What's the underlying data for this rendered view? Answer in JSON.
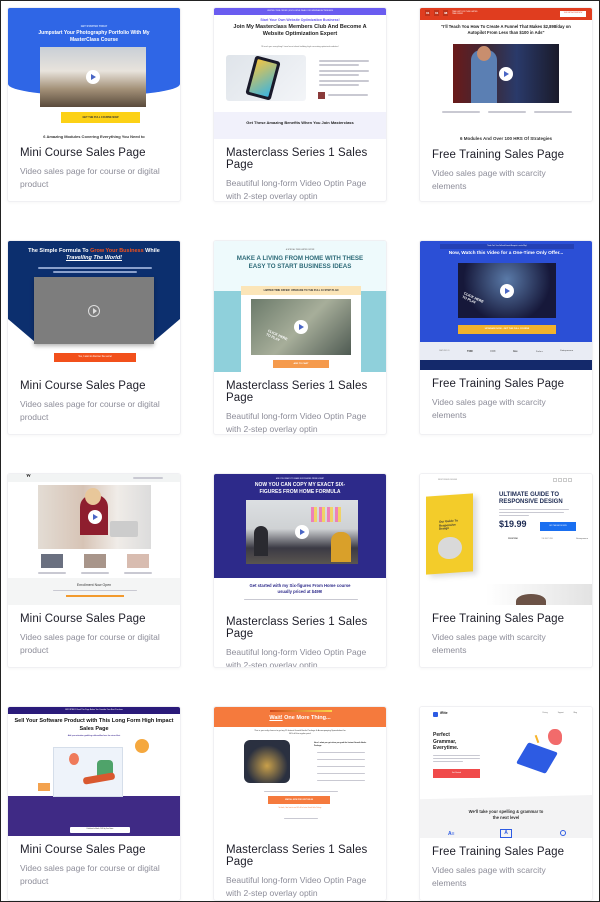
{
  "templates": [
    {
      "title": "Mini Course Sales Page",
      "description": "Video sales page for course or digital product",
      "preview": {
        "eyebrow": "GET STARTED TODAY",
        "headline": "Jumpstart Your Photography Portfolio With My MasterClass Course",
        "cta": "GET THE FULL COURSE NOW",
        "footer": "6 Amazing Modules Covering Everything You Need to",
        "accent": "#2f66e6",
        "cta_color": "#fcd116"
      }
    },
    {
      "title": "Masterclass Series 1 Sales Page",
      "description": "Beautiful long-form Video Optin Page with 2-step overlay optin",
      "preview": {
        "topbar": "LIMITED TIME OFFER | EXCLUSIVE DEAL FOR WEBINAR ATTENDEES",
        "eyebrow": "Start Your Own Website Optimization Business!",
        "headline": "Join My Masterclass Members Club And Become A Website Optimization Expert",
        "subhead": "I'll teach you everything I have learnt about building high converting optimized websites!",
        "section_title": "Get These Amazing Benefits When You Join Masterclass",
        "accent": "#6a5cf0"
      }
    },
    {
      "title": "Free Training Sales Page",
      "description": "Video sales page with scarcity elements",
      "preview": {
        "timer": [
          "01",
          "01",
          "38"
        ],
        "timer_label": "TIME LEFT FOR THIS LIMITED TIME OFFER",
        "top_button": "YES! GET ACCESS NOW",
        "headline": "\"I'll Teach You How To Create A Funnel That Makes $2,898/day on Autopilot From Less than $100 in Ads\"",
        "footer": "6 Modules And Over 100 HRS Of Strategies",
        "accent": "#e03d1f"
      }
    },
    {
      "title": "Mini Course Sales Page",
      "description": "Video sales page for course or digital product",
      "preview": {
        "headline_part1": "The Simple Formula To ",
        "headline_highlight1": "Grow Your Business",
        "headline_part2": " While ",
        "headline_highlight2": "Travelling The World!",
        "cta": "Yes, I want to discover the secret",
        "accent": "#0c2f6e",
        "cta_color": "#f2501b"
      }
    },
    {
      "title": "Masterclass Series 1 Sales Page",
      "description": "Beautiful long-form Video Optin Page with 2-step overlay optin",
      "preview": {
        "eyebrow": "A SPECIAL TIME LIMITED OFFER",
        "headline": "MAKE A LIVING FROM HOME WITH THESE EASY TO START BUSINESS IDEAS",
        "offer_bar": "LIMITED TIME OFFER: UPGRADE TO THE FULL 10 STEP PLAN",
        "video_overlay": "CLICK HERE TO PLAY",
        "cta": "ADD TO CART",
        "accent": "#8fd0db",
        "cta_color": "#f59a4c"
      }
    },
    {
      "title": "Free Training Sales Page",
      "description": "Video sales page with scarcity elements",
      "preview": {
        "topbar": "Thank You! Your Sell and Events Blueprint is on its Way!",
        "headline": "Now, Watch this Video for a One-Time Only Offer...",
        "video_overlay": "CLICK HERE TO PLAY",
        "cta": "UPGRADE NOW - GET THE FULL COURSE",
        "logos": [
          "FEATURED IN",
          "TNW",
          "FOX",
          "Inc.",
          "Forbes",
          "Entrepreneur"
        ],
        "accent": "#2b4fd6",
        "cta_color": "#f2b22c"
      }
    },
    {
      "title": "Mini Course Sales Page",
      "description": "Video sales page for course or digital product",
      "preview": {
        "logo": "W",
        "footer": "Enrollment Now Open",
        "accent": "#f29a2e"
      }
    },
    {
      "title": "Masterclass Series 1 Sales Page",
      "description": "Beautiful long-form Video Optin Page with 2-step overlay optin",
      "preview": {
        "eyebrow": "ARE YOU READY TO MAKE SIX FIGURES FROM HOME?",
        "headline": "NOW YOU CAN COPY MY EXACT SIX-FIGURES FROM HOME FORMULA",
        "subhead": "Get started with my Six-figures From Home course usually priced at $499!",
        "accent": "#2d2a8a"
      }
    },
    {
      "title": "Free Training Sales Page",
      "description": "Video sales page with scarcity elements",
      "preview": {
        "brand": "RESPONSIVE DESIGN",
        "book_title": "Our Guide To Responsive Design",
        "headline": "ULTIMATE GUIDE TO RESPONSIVE DESIGN",
        "price": "$19.99",
        "cta": "BUY THE EBOOK NOW",
        "logos": [
          "FRONTEND",
          "THE NEXT WEB",
          "Entrepreneur"
        ],
        "accent": "#1a6ff0",
        "book_color": "#f3cc2a"
      }
    },
    {
      "title": "Mini Course Sales Page",
      "description": "Video sales page for course or digital product",
      "preview": {
        "topbar": "IMPORTANT: Read This Page Before You Consider Your Next Purchase",
        "headline": "Sell Your Software Product with This Long Form High Impact Sales Page",
        "subhead": "Add your attention grabbing subheadline here for extra effect",
        "byline": "Published in Month, 2020 by Your Name",
        "accent": "#3f2a85"
      }
    },
    {
      "title": "Masterclass Series 1 Sales Page",
      "description": "Beautiful long-form Video Optin Page with 2-step overlay optin",
      "preview": {
        "headline_highlight": "Wait!",
        "headline": " One More Thing...",
        "intro": "This is your only chance to get my 55 Instant Growth Hacks Package & Accompanying Spreadsheet for 50% off the regular price!",
        "list_title": "Here's what you get when you grab the Instant Growth Hacks Package:",
        "cta": "ENROLL NOW FOR JUST $49.99",
        "decline": "No thanks, I don't want to save 50% off the Instant Growth Hacks Package",
        "accent": "#f57a3d"
      }
    },
    {
      "title": "Free Training Sales Page",
      "description": "Video sales page with scarcity elements",
      "preview": {
        "brand": "iRite",
        "nav": [
          "Pricing",
          "Support",
          "Blog"
        ],
        "headline": "Perfect Grammar, Everytime.",
        "cta": "Get Started",
        "section_title": "We'll take your spelling & grammar to the next level",
        "accent": "#f04a4a",
        "illustration_color": "#2d5be3"
      }
    }
  ]
}
